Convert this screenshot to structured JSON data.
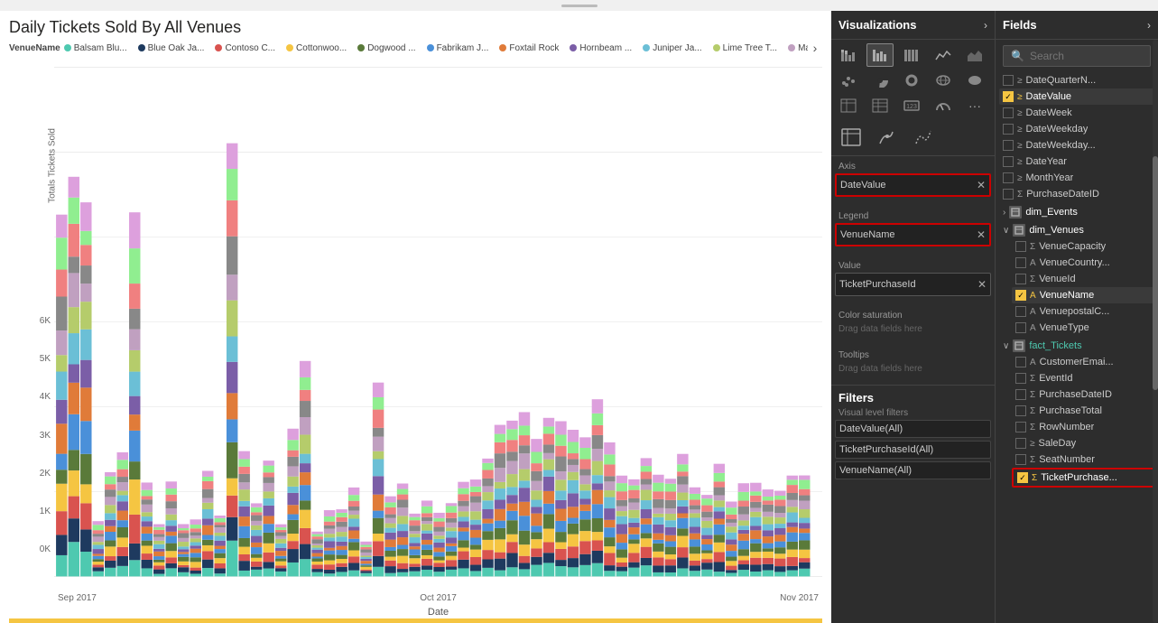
{
  "chart": {
    "title": "Daily Tickets Sold By All Venues",
    "y_axis_label": "Totals Tickets Sold",
    "x_axis_label": "Date",
    "y_ticks": [
      "6K",
      "5K",
      "4K",
      "3K",
      "2K",
      "1K",
      "0K"
    ],
    "x_labels": [
      "Sep 2017",
      "Oct 2017",
      "Nov 2017"
    ],
    "legend_label": "VenueName",
    "legend_items": [
      {
        "name": "Balsam Blu...",
        "color": "#4ec9b0"
      },
      {
        "name": "Blue Oak Ja...",
        "color": "#1e3a5f"
      },
      {
        "name": "Contoso C...",
        "color": "#d9534f"
      },
      {
        "name": "Cottonwoo...",
        "color": "#f5c542"
      },
      {
        "name": "Dogwood ...",
        "color": "#5a7a3a"
      },
      {
        "name": "Fabrikam J...",
        "color": "#4a90d9"
      },
      {
        "name": "Foxtail Rock",
        "color": "#e07b39"
      },
      {
        "name": "Hornbeam ...",
        "color": "#7b5ea7"
      },
      {
        "name": "Juniper Ja...",
        "color": "#6bbfd6"
      },
      {
        "name": "Lime Tree T...",
        "color": "#b5cc6b"
      },
      {
        "name": "Magnolia ...",
        "color": "#c0a0c0"
      }
    ]
  },
  "visualizations_panel": {
    "title": "Visualizations",
    "expand_arrow": "›"
  },
  "fields_panel": {
    "title": "Fields",
    "expand_arrow": "›",
    "search_placeholder": "Search"
  },
  "viz_icons": [
    {
      "name": "stacked-bar-chart-icon",
      "symbol": "▤",
      "active": false
    },
    {
      "name": "bar-chart-icon",
      "symbol": "▥",
      "active": true
    },
    {
      "name": "bar-chart-100-icon",
      "symbol": "▦",
      "active": false
    },
    {
      "name": "line-chart-icon",
      "symbol": "📈",
      "active": false
    },
    {
      "name": "area-chart-icon",
      "symbol": "📉",
      "active": false
    },
    {
      "name": "scatter-chart-icon",
      "symbol": "⋯",
      "active": false
    },
    {
      "name": "pie-chart-icon",
      "symbol": "◕",
      "active": false
    },
    {
      "name": "donut-chart-icon",
      "symbol": "◎",
      "active": false
    },
    {
      "name": "treemap-icon",
      "symbol": "▪",
      "active": false
    },
    {
      "name": "waterfall-icon",
      "symbol": "≡",
      "active": false
    },
    {
      "name": "funnel-icon",
      "symbol": "⌽",
      "active": false
    },
    {
      "name": "gauge-icon",
      "symbol": "◉",
      "active": false
    },
    {
      "name": "card-icon",
      "symbol": "▭",
      "active": false
    },
    {
      "name": "table-icon",
      "symbol": "⊞",
      "active": false
    },
    {
      "name": "matrix-icon",
      "symbol": "⊟",
      "active": false
    }
  ],
  "viz_bottom_icons": [
    {
      "name": "fields-tab-icon",
      "symbol": "⊟"
    },
    {
      "name": "format-tab-icon",
      "symbol": "🖌"
    },
    {
      "name": "analytics-tab-icon",
      "symbol": "📊"
    }
  ],
  "axis_zone": {
    "label": "Axis",
    "value": "DateValue",
    "highlighted": true
  },
  "legend_zone": {
    "label": "Legend",
    "value": "VenueName",
    "highlighted": true
  },
  "value_zone": {
    "label": "Value",
    "value": "TicketPurchaseId",
    "highlighted": false
  },
  "color_saturation_zone": {
    "label": "Color saturation",
    "placeholder": "Drag data fields here"
  },
  "tooltips_zone": {
    "label": "Tooltips",
    "placeholder": "Drag data fields here"
  },
  "filters": {
    "title": "Filters",
    "visual_level_label": "Visual level filters",
    "items": [
      {
        "name": "DateValue(All)"
      },
      {
        "name": "TicketPurchaseId(All)"
      },
      {
        "name": "VenueName(All)"
      }
    ]
  },
  "fields": {
    "date_fields": [
      {
        "name": "DateQuarterN...",
        "checked": false,
        "icon": "calendar"
      },
      {
        "name": "DateValue",
        "checked": true,
        "icon": "calendar",
        "highlighted": true
      },
      {
        "name": "DateWeek",
        "checked": false,
        "icon": "calendar"
      },
      {
        "name": "DateWeekday",
        "checked": false,
        "icon": "calendar"
      },
      {
        "name": "DateWeekday...",
        "checked": false,
        "icon": "calendar"
      },
      {
        "name": "DateYear",
        "checked": false,
        "icon": "calendar"
      },
      {
        "name": "MonthYear",
        "checked": false,
        "icon": "calendar"
      },
      {
        "name": "PurchaseDateID",
        "checked": false,
        "icon": "sigma"
      }
    ],
    "dim_events_section": {
      "name": "dim_Events",
      "collapsed": true
    },
    "dim_venues_section": {
      "name": "dim_Venues",
      "collapsed": false,
      "fields": [
        {
          "name": "VenueCapacity",
          "checked": false,
          "icon": "sigma"
        },
        {
          "name": "VenueCountry...",
          "checked": false,
          "icon": "text"
        },
        {
          "name": "VenueId",
          "checked": false,
          "icon": "sigma"
        },
        {
          "name": "VenueName",
          "checked": true,
          "icon": "text",
          "highlighted": true
        },
        {
          "name": "VenuepostalC...",
          "checked": false,
          "icon": "text"
        },
        {
          "name": "VenueType",
          "checked": false,
          "icon": "text"
        }
      ]
    },
    "fact_tickets_section": {
      "name": "fact_Tickets",
      "collapsed": false,
      "fields": [
        {
          "name": "CustomerEmai...",
          "checked": false,
          "icon": "text"
        },
        {
          "name": "EventId",
          "checked": false,
          "icon": "sigma"
        },
        {
          "name": "PurchaseDateID",
          "checked": false,
          "icon": "sigma"
        },
        {
          "name": "PurchaseTotal",
          "checked": false,
          "icon": "sigma"
        },
        {
          "name": "RowNumber",
          "checked": false,
          "icon": "sigma"
        },
        {
          "name": "SaleDay",
          "checked": false,
          "icon": "calendar"
        },
        {
          "name": "SeatNumber",
          "checked": false,
          "icon": "sigma"
        },
        {
          "name": "TicketPurchase...",
          "checked": true,
          "icon": "sigma",
          "highlighted": true
        }
      ]
    }
  }
}
